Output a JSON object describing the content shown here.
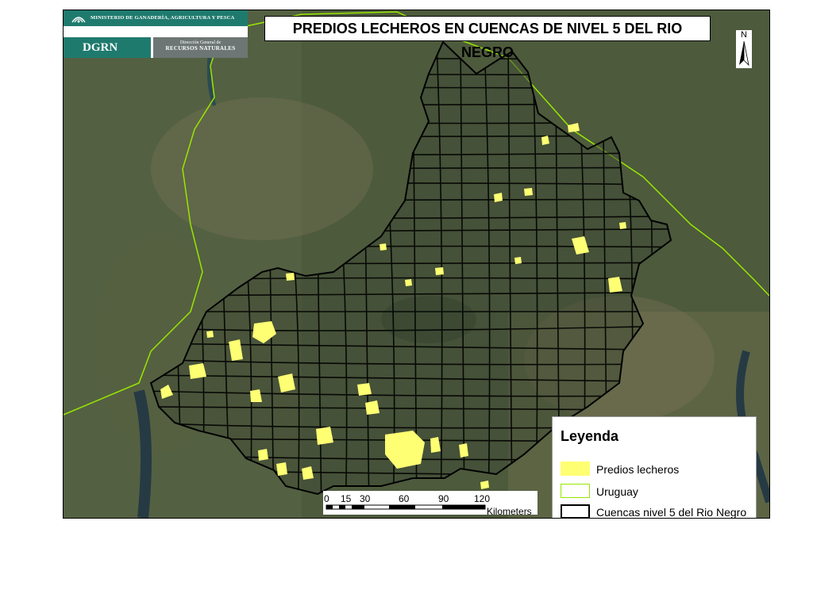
{
  "title": "PREDIOS LECHEROS EN CUENCAS DE NIVEL 5 DEL RIO NEGRO",
  "logo": {
    "ministry": "MINISTERIO DE GANADERÍA, AGRICULTURA Y PESCA",
    "acronym": "DGRN",
    "sub_line1": "Dirección General de",
    "sub_line2": "RECURSOS NATURALES"
  },
  "north_arrow": {
    "label": "N"
  },
  "scale": {
    "ticks": [
      "0",
      "15",
      "30",
      "60",
      "90",
      "120"
    ],
    "unit": "Kilometers"
  },
  "legend": {
    "title": "Leyenda",
    "items": [
      {
        "label": "Predios lecheros",
        "swatch_color": "#ffff73",
        "swatch_style": "fill"
      },
      {
        "label": "Uruguay",
        "swatch_color": "#98e600",
        "swatch_style": "outline"
      },
      {
        "label": "Cuencas nivel 5 del Rio Negro",
        "swatch_color": "#000000",
        "swatch_style": "outline"
      }
    ]
  },
  "colors": {
    "imagery_base": "#4d5a3c",
    "basin_lines": "#000000",
    "border_line": "#98e600",
    "dairy_farms": "#ffff73",
    "logo_green": "#1f7a6e"
  }
}
